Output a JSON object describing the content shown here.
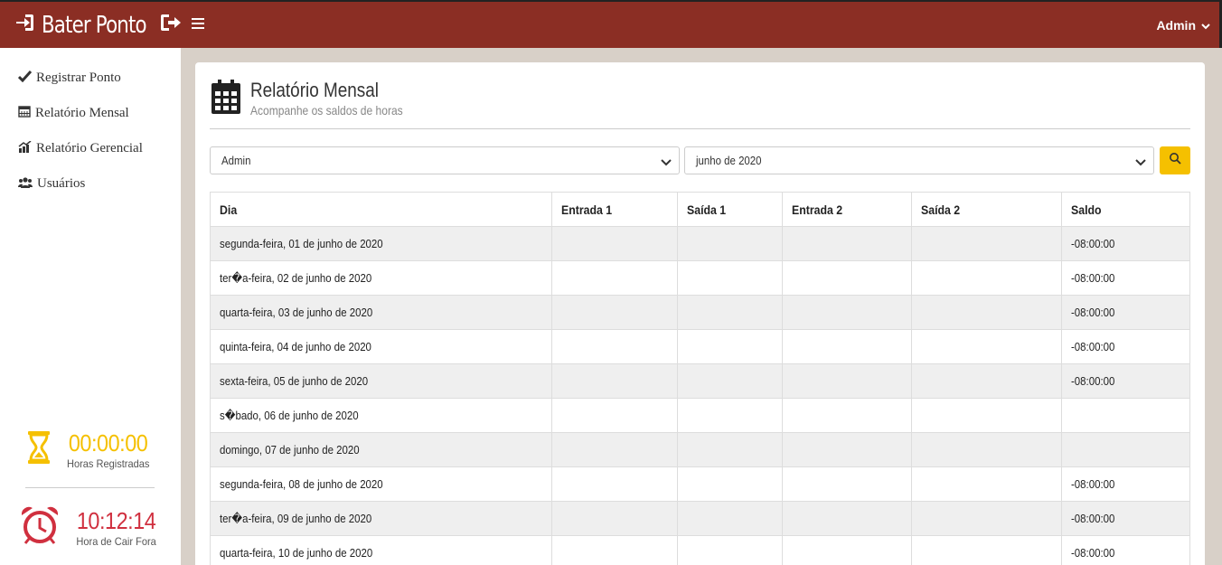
{
  "header": {
    "brand": "Bater Ponto",
    "user": "Admin"
  },
  "sidebar": {
    "items": [
      {
        "label": "Registrar Ponto",
        "icon": "check-icon"
      },
      {
        "label": "Relatório Mensal",
        "icon": "calendar-icon"
      },
      {
        "label": "Relatório Gerencial",
        "icon": "chart-icon"
      },
      {
        "label": "Usuários",
        "icon": "users-icon"
      }
    ],
    "hours": {
      "value": "00:00:00",
      "label": "Horas Registradas",
      "color": "#f5c000"
    },
    "leave": {
      "value": "10:12:14",
      "label": "Hora de Cair Fora",
      "color": "#d0303f"
    }
  },
  "main": {
    "title": "Relatório Mensal",
    "subtitle": "Acompanhe os saldos de horas",
    "user_select": "Admin",
    "month_select": "junho de 2020",
    "table": {
      "headers": [
        "Dia",
        "Entrada 1",
        "Saída 1",
        "Entrada 2",
        "Saída 2",
        "Saldo"
      ],
      "rows": [
        [
          "segunda-feira, 01 de junho de 2020",
          "",
          "",
          "",
          "",
          "-08:00:00"
        ],
        [
          "ter�a-feira, 02 de junho de 2020",
          "",
          "",
          "",
          "",
          "-08:00:00"
        ],
        [
          "quarta-feira, 03 de junho de 2020",
          "",
          "",
          "",
          "",
          "-08:00:00"
        ],
        [
          "quinta-feira, 04 de junho de 2020",
          "",
          "",
          "",
          "",
          "-08:00:00"
        ],
        [
          "sexta-feira, 05 de junho de 2020",
          "",
          "",
          "",
          "",
          "-08:00:00"
        ],
        [
          "s�bado, 06 de junho de 2020",
          "",
          "",
          "",
          "",
          ""
        ],
        [
          "domingo, 07 de junho de 2020",
          "",
          "",
          "",
          "",
          ""
        ],
        [
          "segunda-feira, 08 de junho de 2020",
          "",
          "",
          "",
          "",
          "-08:00:00"
        ],
        [
          "ter�a-feira, 09 de junho de 2020",
          "",
          "",
          "",
          "",
          "-08:00:00"
        ],
        [
          "quarta-feira, 10 de junho de 2020",
          "",
          "",
          "",
          "",
          "-08:00:00"
        ]
      ]
    }
  }
}
